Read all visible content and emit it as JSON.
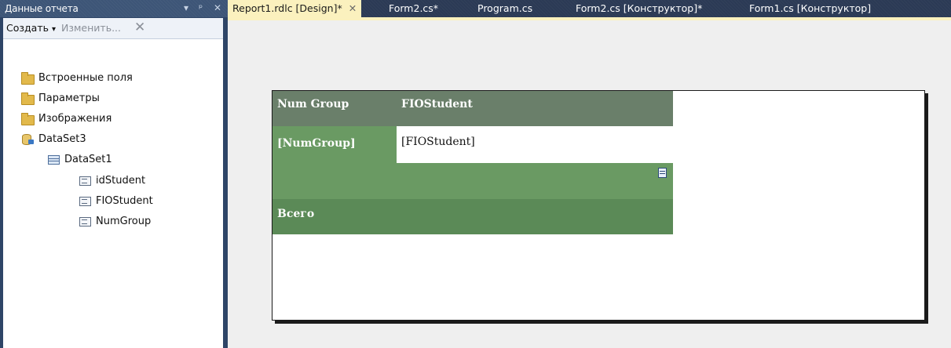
{
  "panel": {
    "title": "Данные отчета",
    "controls": [
      "▾",
      "ᵖ",
      "✕"
    ],
    "toolbar": {
      "create_label": "Создать",
      "create_arrow": "▾",
      "edit_label": "Изменить...",
      "delete_icon": "✕"
    },
    "tree": [
      {
        "label": "Встроенные поля",
        "icon": "folder-icon"
      },
      {
        "label": "Параметры",
        "icon": "folder-icon"
      },
      {
        "label": "Изображения",
        "icon": "folder-icon"
      },
      {
        "label": "DataSet3",
        "icon": "dataset-icon"
      },
      {
        "label": "DataSet1",
        "icon": "table-icon"
      },
      {
        "label": "idStudent",
        "icon": "field-icon"
      },
      {
        "label": "FIOStudent",
        "icon": "field-icon"
      },
      {
        "label": "NumGroup",
        "icon": "field-icon"
      }
    ]
  },
  "tabs": [
    {
      "label": "Report1.rdlc [Design]*",
      "close": "✕"
    },
    {
      "label": "Form2.cs*"
    },
    {
      "label": "Program.cs"
    },
    {
      "label": "Form2.cs [Конструктор]*"
    },
    {
      "label": "Form1.cs [Конструктор]"
    }
  ],
  "report": {
    "header": [
      "Num Group",
      "FIOStudent"
    ],
    "group_cell": "[NumGroup]",
    "detail_cell": "[FIOStudent]",
    "total_label": "Всего",
    "colors": {
      "header": "#6a7f6a",
      "group": "#6a9a63",
      "total": "#5b8a57",
      "active_tab": "#fbf1be"
    }
  }
}
